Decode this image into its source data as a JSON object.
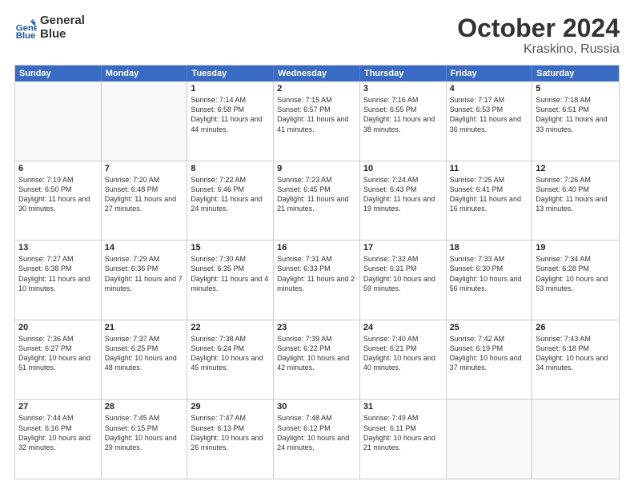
{
  "header": {
    "logo_line1": "General",
    "logo_line2": "Blue",
    "title": "October 2024",
    "subtitle": "Kraskino, Russia"
  },
  "weekdays": [
    "Sunday",
    "Monday",
    "Tuesday",
    "Wednesday",
    "Thursday",
    "Friday",
    "Saturday"
  ],
  "rows": [
    [
      {
        "day": "",
        "text": "",
        "empty": true
      },
      {
        "day": "",
        "text": "",
        "empty": true
      },
      {
        "day": "1",
        "text": "Sunrise: 7:14 AM\nSunset: 6:58 PM\nDaylight: 11 hours and 44 minutes."
      },
      {
        "day": "2",
        "text": "Sunrise: 7:15 AM\nSunset: 6:57 PM\nDaylight: 11 hours and 41 minutes."
      },
      {
        "day": "3",
        "text": "Sunrise: 7:16 AM\nSunset: 6:55 PM\nDaylight: 11 hours and 38 minutes."
      },
      {
        "day": "4",
        "text": "Sunrise: 7:17 AM\nSunset: 6:53 PM\nDaylight: 11 hours and 36 minutes."
      },
      {
        "day": "5",
        "text": "Sunrise: 7:18 AM\nSunset: 6:51 PM\nDaylight: 11 hours and 33 minutes."
      }
    ],
    [
      {
        "day": "6",
        "text": "Sunrise: 7:19 AM\nSunset: 6:50 PM\nDaylight: 11 hours and 30 minutes."
      },
      {
        "day": "7",
        "text": "Sunrise: 7:20 AM\nSunset: 6:48 PM\nDaylight: 11 hours and 27 minutes."
      },
      {
        "day": "8",
        "text": "Sunrise: 7:22 AM\nSunset: 6:46 PM\nDaylight: 11 hours and 24 minutes."
      },
      {
        "day": "9",
        "text": "Sunrise: 7:23 AM\nSunset: 6:45 PM\nDaylight: 11 hours and 21 minutes."
      },
      {
        "day": "10",
        "text": "Sunrise: 7:24 AM\nSunset: 6:43 PM\nDaylight: 11 hours and 19 minutes."
      },
      {
        "day": "11",
        "text": "Sunrise: 7:25 AM\nSunset: 6:41 PM\nDaylight: 11 hours and 16 minutes."
      },
      {
        "day": "12",
        "text": "Sunrise: 7:26 AM\nSunset: 6:40 PM\nDaylight: 11 hours and 13 minutes."
      }
    ],
    [
      {
        "day": "13",
        "text": "Sunrise: 7:27 AM\nSunset: 6:38 PM\nDaylight: 11 hours and 10 minutes."
      },
      {
        "day": "14",
        "text": "Sunrise: 7:29 AM\nSunset: 6:36 PM\nDaylight: 11 hours and 7 minutes."
      },
      {
        "day": "15",
        "text": "Sunrise: 7:30 AM\nSunset: 6:35 PM\nDaylight: 11 hours and 4 minutes."
      },
      {
        "day": "16",
        "text": "Sunrise: 7:31 AM\nSunset: 6:33 PM\nDaylight: 11 hours and 2 minutes."
      },
      {
        "day": "17",
        "text": "Sunrise: 7:32 AM\nSunset: 6:31 PM\nDaylight: 10 hours and 59 minutes."
      },
      {
        "day": "18",
        "text": "Sunrise: 7:33 AM\nSunset: 6:30 PM\nDaylight: 10 hours and 56 minutes."
      },
      {
        "day": "19",
        "text": "Sunrise: 7:34 AM\nSunset: 6:28 PM\nDaylight: 10 hours and 53 minutes."
      }
    ],
    [
      {
        "day": "20",
        "text": "Sunrise: 7:36 AM\nSunset: 6:27 PM\nDaylight: 10 hours and 51 minutes."
      },
      {
        "day": "21",
        "text": "Sunrise: 7:37 AM\nSunset: 6:25 PM\nDaylight: 10 hours and 48 minutes."
      },
      {
        "day": "22",
        "text": "Sunrise: 7:38 AM\nSunset: 6:24 PM\nDaylight: 10 hours and 45 minutes."
      },
      {
        "day": "23",
        "text": "Sunrise: 7:39 AM\nSunset: 6:22 PM\nDaylight: 10 hours and 42 minutes."
      },
      {
        "day": "24",
        "text": "Sunrise: 7:40 AM\nSunset: 6:21 PM\nDaylight: 10 hours and 40 minutes."
      },
      {
        "day": "25",
        "text": "Sunrise: 7:42 AM\nSunset: 6:19 PM\nDaylight: 10 hours and 37 minutes."
      },
      {
        "day": "26",
        "text": "Sunrise: 7:43 AM\nSunset: 6:18 PM\nDaylight: 10 hours and 34 minutes."
      }
    ],
    [
      {
        "day": "27",
        "text": "Sunrise: 7:44 AM\nSunset: 6:16 PM\nDaylight: 10 hours and 32 minutes."
      },
      {
        "day": "28",
        "text": "Sunrise: 7:45 AM\nSunset: 6:15 PM\nDaylight: 10 hours and 29 minutes."
      },
      {
        "day": "29",
        "text": "Sunrise: 7:47 AM\nSunset: 6:13 PM\nDaylight: 10 hours and 26 minutes."
      },
      {
        "day": "30",
        "text": "Sunrise: 7:48 AM\nSunset: 6:12 PM\nDaylight: 10 hours and 24 minutes."
      },
      {
        "day": "31",
        "text": "Sunrise: 7:49 AM\nSunset: 6:11 PM\nDaylight: 10 hours and 21 minutes."
      },
      {
        "day": "",
        "text": "",
        "empty": true
      },
      {
        "day": "",
        "text": "",
        "empty": true
      }
    ]
  ]
}
